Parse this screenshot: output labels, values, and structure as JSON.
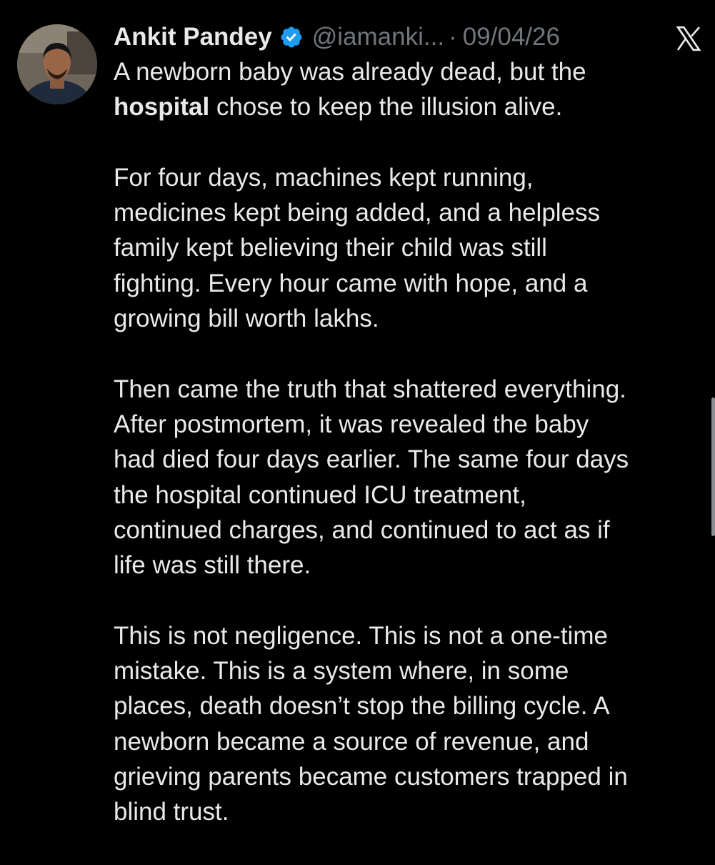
{
  "author": {
    "name": "Ankit Pandey",
    "handle": "@iamanki...",
    "separator": "·",
    "date": "09/04/26",
    "verified": true
  },
  "icons": {
    "avatar": "profile-photo",
    "verified": "verified-badge-icon",
    "platform": "x-logo-icon"
  },
  "colors": {
    "background": "#000000",
    "text": "#e7e9ea",
    "secondary_text": "#71767b",
    "verified_blue": "#1d9bf0"
  },
  "tweet": {
    "p1": {
      "l1": "A newborn baby was already dead, but the",
      "l2_bold": "hospital",
      "l2_rest": " chose to keep the illusion alive."
    },
    "p2": [
      "For four days, machines kept running,",
      "medicines kept being added, and a helpless",
      "family kept believing their child was still",
      "fighting. Every hour came with hope, and a",
      "growing bill worth lakhs."
    ],
    "p3": [
      "Then came the truth that shattered everything.",
      "After postmortem, it was revealed the baby",
      "had died four days earlier. The same four days",
      "the hospital continued ICU treatment,",
      "continued charges, and continued to act as if",
      "life was still there."
    ],
    "p4": [
      "This is not negligence. This is not a one-time",
      "mistake. This is a system where, in some",
      "places, death doesn’t stop the billing cycle. A",
      "newborn became a source of revenue, and",
      "grieving parents became customers trapped in",
      "blind trust."
    ]
  }
}
